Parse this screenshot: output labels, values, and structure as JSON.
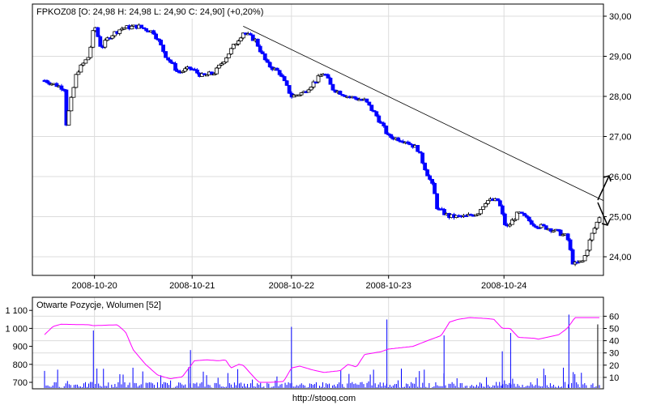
{
  "chart_data": [
    {
      "type": "candlestick",
      "title": "FPKOZ08 [O: 24,98  H: 24,98  L: 24,90  C: 24,90] (+0,20%)",
      "x_tick_labels": [
        "2008-10-20",
        "2008-10-21",
        "2008-10-22",
        "2008-10-23",
        "2008-10-24"
      ],
      "x_tick_positions_t": [
        9,
        26.6,
        44.5,
        62,
        82.8
      ],
      "y_tick_labels": [
        "30,00",
        "29,00",
        "28,00",
        "27,00",
        "26,00",
        "25,00",
        "24,00"
      ],
      "y_ticks": [
        30,
        29,
        28,
        27,
        26,
        25,
        24
      ],
      "ylim": [
        23.7,
        30.3
      ],
      "grid": true,
      "color_up": "#000000",
      "color_down": "#0000ff",
      "price_path": [
        [
          0,
          28.4
        ],
        [
          3.6,
          28.2
        ],
        [
          3.9,
          27.3
        ],
        [
          5.8,
          28.6
        ],
        [
          8,
          29
        ],
        [
          9,
          29.8
        ],
        [
          10.2,
          29.2
        ],
        [
          11.7,
          29.5
        ],
        [
          13.9,
          29.7
        ],
        [
          16.8,
          29.75
        ],
        [
          19.7,
          29.6
        ],
        [
          21.9,
          29.0
        ],
        [
          24.1,
          28.6
        ],
        [
          26.3,
          28.7
        ],
        [
          28.5,
          28.5
        ],
        [
          30.7,
          28.6
        ],
        [
          32.8,
          29.0
        ],
        [
          35.8,
          29.6
        ],
        [
          38,
          29.4
        ],
        [
          40.1,
          28.8
        ],
        [
          42.3,
          28.6
        ],
        [
          44.5,
          28.0
        ],
        [
          46.7,
          28.1
        ],
        [
          48.9,
          28.4
        ],
        [
          50.4,
          28.6
        ],
        [
          51.8,
          28.2
        ],
        [
          54.7,
          28.0
        ],
        [
          57.7,
          27.9
        ],
        [
          59.9,
          27.5
        ],
        [
          62,
          27.0
        ],
        [
          65,
          26.9
        ],
        [
          67.2,
          26.7
        ],
        [
          68.6,
          26.2
        ],
        [
          70.1,
          25.7
        ],
        [
          70.8,
          25.2
        ],
        [
          73,
          25.0
        ],
        [
          75.9,
          25.0
        ],
        [
          78.1,
          25.1
        ],
        [
          79.6,
          25.4
        ],
        [
          81.8,
          25.4
        ],
        [
          83.2,
          24.7
        ],
        [
          85.4,
          25.1
        ],
        [
          88.3,
          24.8
        ],
        [
          91.2,
          24.7
        ],
        [
          94.2,
          24.5
        ],
        [
          95.3,
          23.8
        ],
        [
          97.1,
          23.9
        ],
        [
          98.5,
          24.5
        ],
        [
          100,
          25.0
        ]
      ],
      "trendline": [
        [
          35.8,
          29.75
        ],
        [
          100,
          25.3
        ]
      ]
    },
    {
      "type": "bar+line",
      "title": "Otwarte Pozycje, Wolumen [52]",
      "left_axis_labels": [
        "1 100",
        "1 000",
        "900",
        "800",
        "700"
      ],
      "left_ticks": [
        1100,
        1000,
        900,
        800,
        700
      ],
      "left_ylim": [
        670,
        1130
      ],
      "right_axis_labels": [
        "60",
        "50",
        "40",
        "30",
        "20",
        "10"
      ],
      "right_ticks": [
        60,
        50,
        40,
        30,
        20,
        10
      ],
      "right_ylim": [
        0,
        66
      ],
      "open_interest_color": "#ff00ff",
      "volume_color": "#0000ff",
      "open_interest": [
        [
          0,
          965
        ],
        [
          1.5,
          1010
        ],
        [
          2.9,
          1023
        ],
        [
          8,
          1020
        ],
        [
          8.8,
          1015
        ],
        [
          13.1,
          1020
        ],
        [
          14.6,
          980
        ],
        [
          16,
          880
        ],
        [
          18.2,
          800
        ],
        [
          20.4,
          740
        ],
        [
          22.6,
          720
        ],
        [
          24.8,
          730
        ],
        [
          26.3,
          790
        ],
        [
          27,
          820
        ],
        [
          29.2,
          825
        ],
        [
          31.4,
          820
        ],
        [
          32.6,
          825
        ],
        [
          33.6,
          780
        ],
        [
          35,
          800
        ],
        [
          35.8,
          795
        ],
        [
          38,
          720
        ],
        [
          38.7,
          700
        ],
        [
          40.9,
          700
        ],
        [
          43.1,
          705
        ],
        [
          44.5,
          780
        ],
        [
          46,
          790
        ],
        [
          48.2,
          770
        ],
        [
          50.4,
          755
        ],
        [
          53.3,
          765
        ],
        [
          54.7,
          800
        ],
        [
          56.2,
          785
        ],
        [
          57.7,
          855
        ],
        [
          60.6,
          870
        ],
        [
          62,
          885
        ],
        [
          66.4,
          900
        ],
        [
          69.3,
          935
        ],
        [
          71.5,
          960
        ],
        [
          73,
          1035
        ],
        [
          74.5,
          1050
        ],
        [
          76.6,
          1060
        ],
        [
          79.6,
          1055
        ],
        [
          81,
          1050
        ],
        [
          82.5,
          1000
        ],
        [
          83.9,
          1000
        ],
        [
          85.4,
          950
        ],
        [
          88.3,
          945
        ],
        [
          89,
          940
        ],
        [
          91.2,
          955
        ],
        [
          92.7,
          965
        ],
        [
          94.2,
          1000
        ],
        [
          95.6,
          1060
        ],
        [
          100,
          1060
        ]
      ],
      "volume_spikes": [
        [
          8.8,
          47
        ],
        [
          26.3,
          31
        ],
        [
          44.5,
          50
        ],
        [
          61.7,
          56
        ],
        [
          72,
          43
        ],
        [
          82.5,
          30
        ],
        [
          84,
          45
        ],
        [
          94.5,
          60
        ],
        [
          99.7,
          52
        ]
      ]
    }
  ],
  "footer": "http://stooq.com"
}
